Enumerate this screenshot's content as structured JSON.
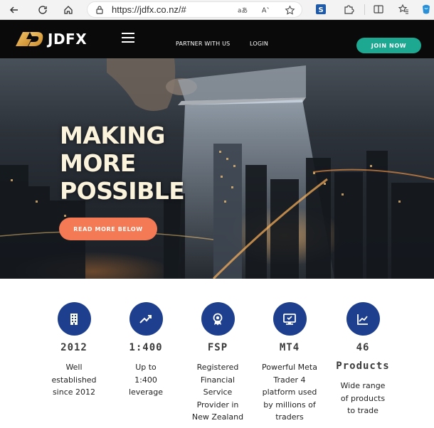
{
  "browser": {
    "url": "https://jdfx.co.nz/#"
  },
  "header": {
    "logo_text": "JDFX",
    "nav": [
      {
        "label": "PARTNER WITH US"
      },
      {
        "label": "LOGIN"
      }
    ],
    "cta_label": "JOIN NOW",
    "cta_color": "#1ca891"
  },
  "hero": {
    "title_lines": [
      "MAKING",
      "MORE",
      "POSSIBLE"
    ],
    "button_label": "READ MORE BELOW",
    "button_color": "#f37a54"
  },
  "features": [
    {
      "icon": "building-icon",
      "stat": "2012",
      "description": "Well established since 2012"
    },
    {
      "icon": "trend-up-icon",
      "stat": "1:400",
      "description": "Up to 1:400 leverage"
    },
    {
      "icon": "award-badge-icon",
      "stat": "FSP",
      "description": "Registered Financial Service Provider in New Zealand"
    },
    {
      "icon": "monitor-icon",
      "stat": "MT4",
      "description": "Powerful Meta Trader 4 platform used by millions of traders"
    },
    {
      "icon": "chart-icon",
      "stat": "46",
      "stat_line2": "Products",
      "description": "Wide range of products to trade"
    }
  ],
  "colors": {
    "feature_circle": "#1d3f8e",
    "header_bg": "#0a0a0a"
  }
}
